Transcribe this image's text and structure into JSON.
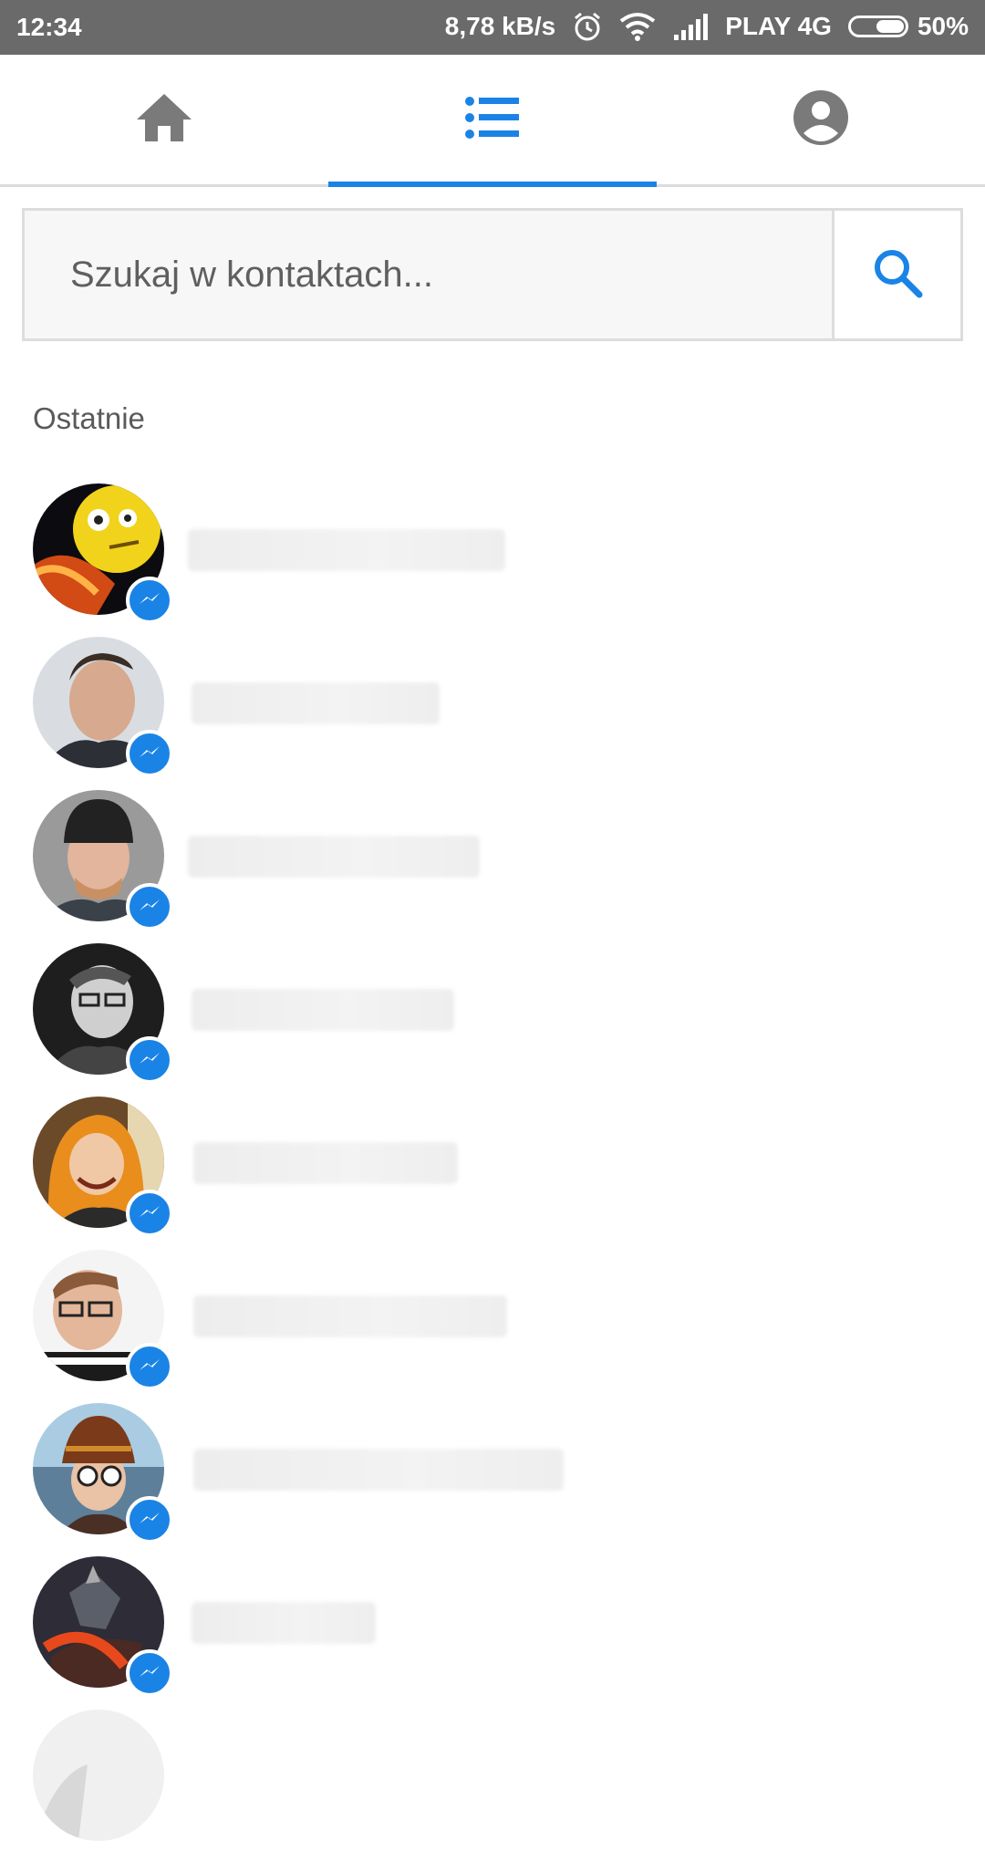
{
  "status_bar": {
    "time": "12:34",
    "speed": "8,78 kB/s",
    "carrier": "PLAY 4G",
    "battery": "50%"
  },
  "tabs": [
    {
      "icon": "home-icon",
      "active": false
    },
    {
      "icon": "list-icon",
      "active": true
    },
    {
      "icon": "profile-icon",
      "active": false
    }
  ],
  "search": {
    "placeholder": "Szukaj w kontaktach..."
  },
  "section": {
    "label": "Ostatnie"
  },
  "colors": {
    "accent": "#1a83e6",
    "status_bar": "#6a6a6a"
  }
}
